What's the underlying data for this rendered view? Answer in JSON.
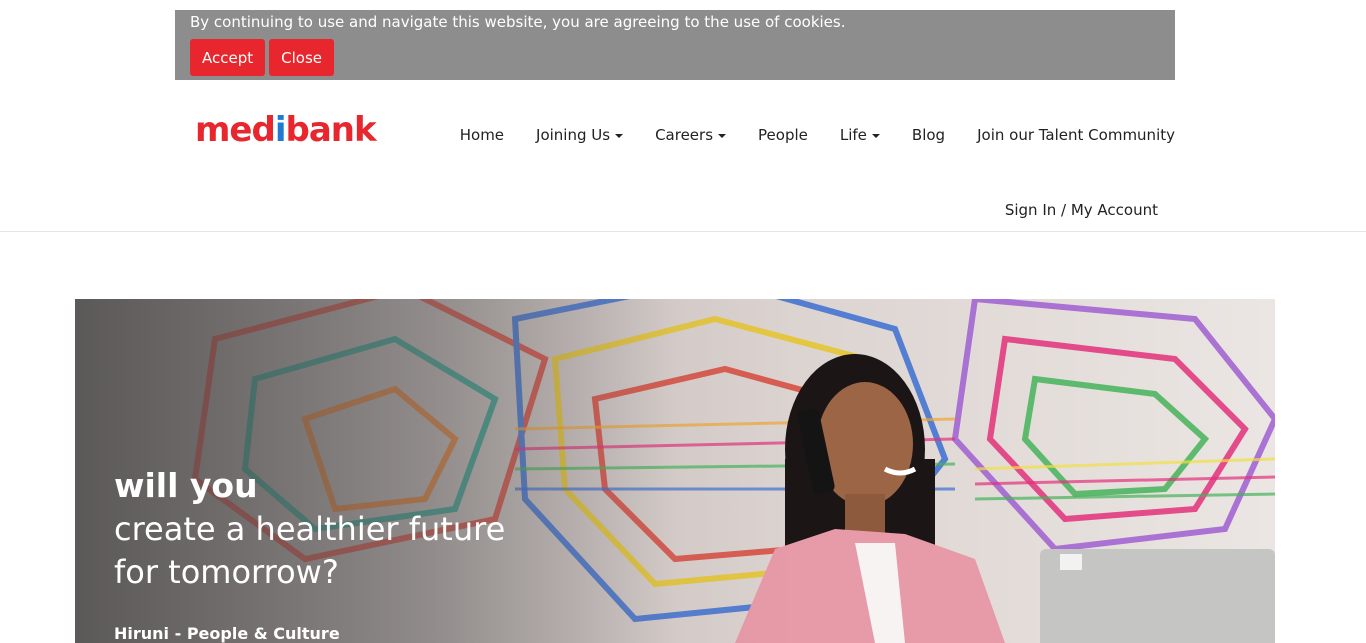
{
  "cookie_banner": {
    "message": "By continuing to use and navigate this website, you are agreeing to the use of cookies.",
    "accept_label": "Accept",
    "close_label": "Close"
  },
  "logo": {
    "part1": "med",
    "part2": "i",
    "part3": "bank"
  },
  "nav": {
    "items": [
      {
        "label": "Home"
      },
      {
        "label": "Joining Us"
      },
      {
        "label": "Careers"
      },
      {
        "label": "People"
      },
      {
        "label": "Life"
      },
      {
        "label": "Blog"
      },
      {
        "label": "Join our Talent Community"
      }
    ],
    "signin_label": "Sign In / My Account"
  },
  "hero": {
    "line1": "will you",
    "line2": "create a healthier future",
    "line3": "for tomorrow?",
    "caption": "Hiruni - People & Culture"
  },
  "colors": {
    "brand_red": "#e8262d",
    "brand_blue": "#1e7ad3",
    "cookie_bg": "#8d8d8d"
  }
}
